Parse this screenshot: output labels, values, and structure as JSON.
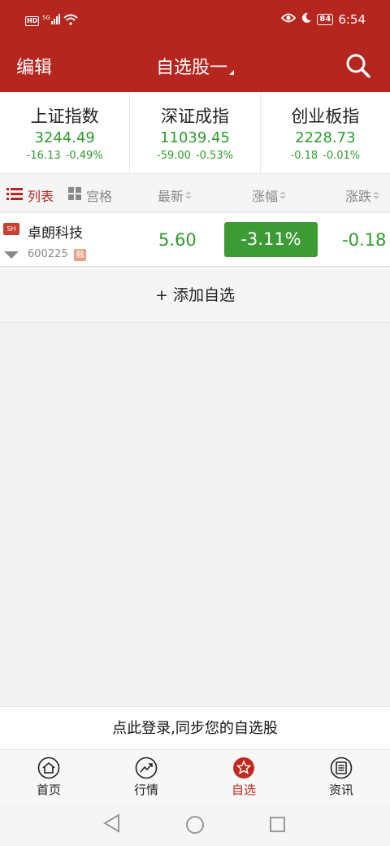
{
  "status_bar": {
    "left_icons": [
      "hd-icon",
      "5g-signal-icon",
      "wifi-icon"
    ],
    "hd": "HD",
    "network": "5G",
    "battery": "84",
    "time": "6:54"
  },
  "header": {
    "edit_label": "编辑",
    "title": "自选股一",
    "search_icon": "search-icon"
  },
  "indices": [
    {
      "name": "上证指数",
      "value": "3244.49",
      "change": "-16.13",
      "percent": "-0.49%"
    },
    {
      "name": "深证成指",
      "value": "11039.45",
      "change": "-59.00",
      "percent": "-0.53%"
    },
    {
      "name": "创业板指",
      "value": "2228.73",
      "change": "-0.18",
      "percent": "-0.01%"
    }
  ],
  "columns": {
    "list_tab": "列表",
    "grid_tab": "宫格",
    "latest": "最新",
    "change_pct": "涨幅",
    "change_amt": "涨跌"
  },
  "stocks": [
    {
      "market": "SH",
      "name": "卓朗科技",
      "code": "600225",
      "margin_tag": "融",
      "price": "5.60",
      "change_pct": "-3.11%",
      "change_amt": "-0.18"
    }
  ],
  "add_label": "+ 添加自选",
  "login_prompt": "点此登录,同步您的自选股",
  "tabs": [
    {
      "label": "首页",
      "icon": "home-icon",
      "active": false
    },
    {
      "label": "行情",
      "icon": "market-trend-icon",
      "active": false
    },
    {
      "label": "自选",
      "icon": "star-icon",
      "active": true
    },
    {
      "label": "资讯",
      "icon": "news-icon",
      "active": false
    }
  ],
  "colors": {
    "brand_red": "#b5261e",
    "down_green": "#2e9a2e",
    "active_tab": "#c0291f"
  }
}
